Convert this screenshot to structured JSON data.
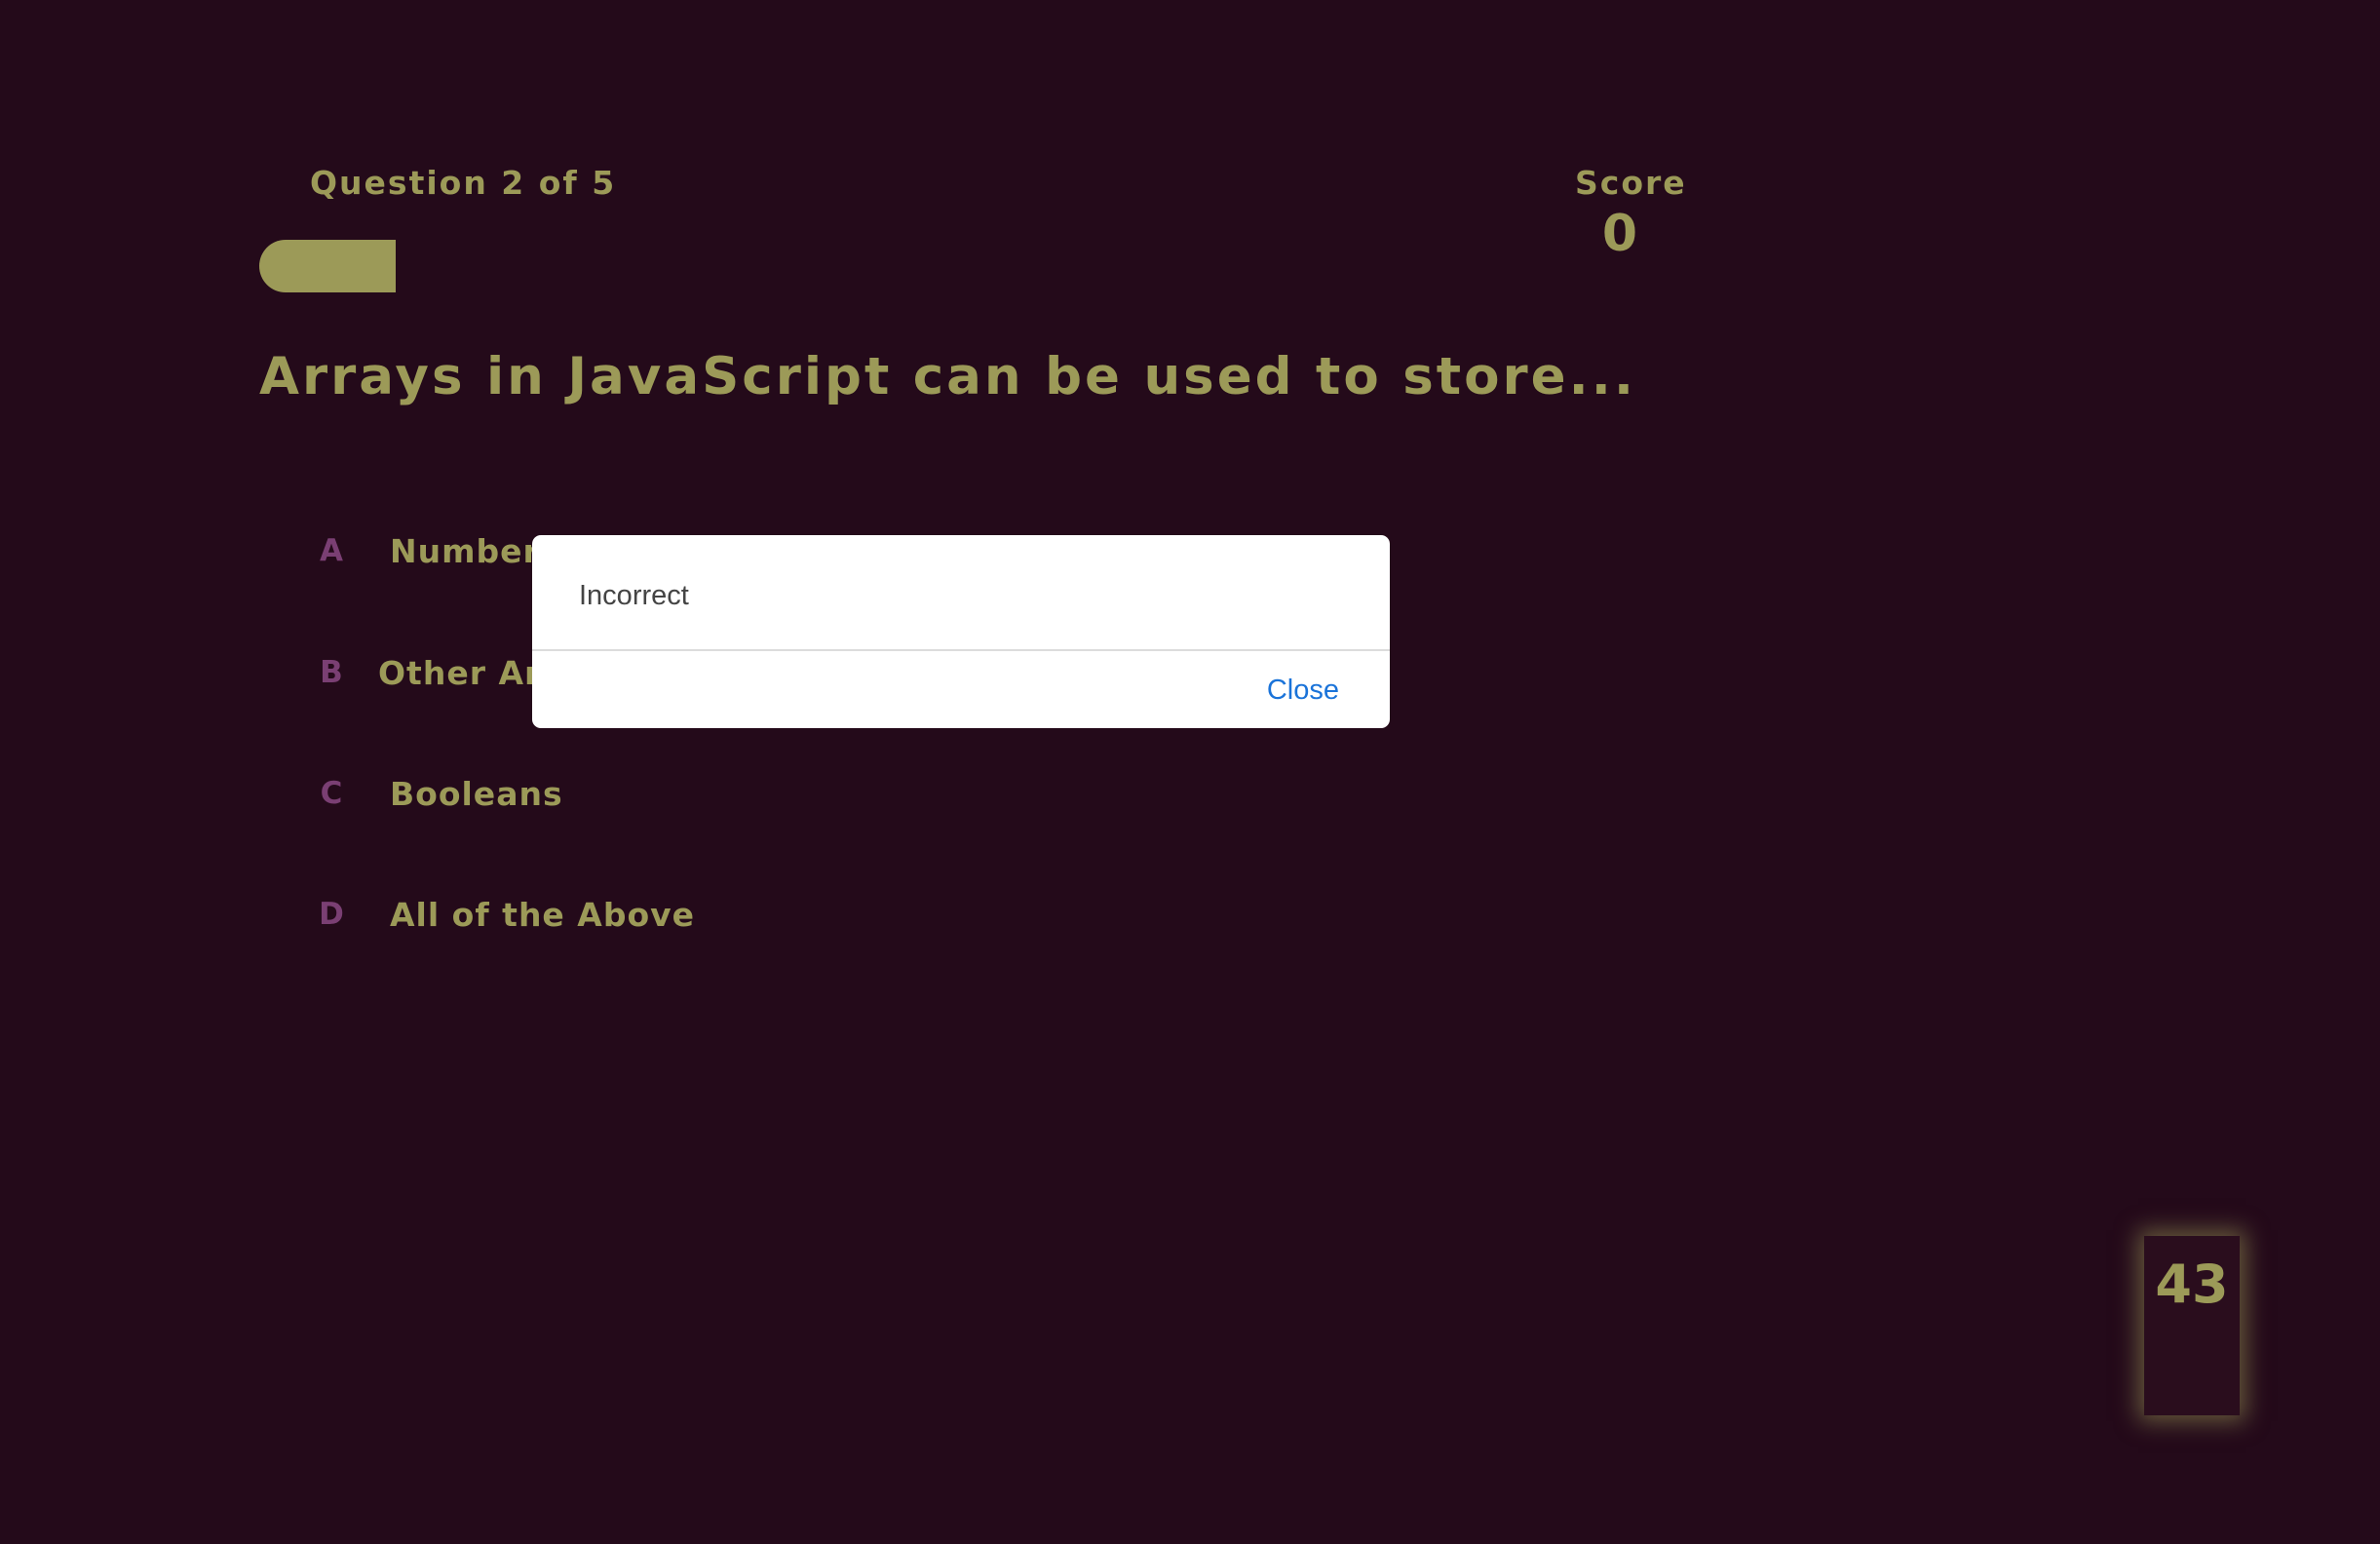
{
  "header": {
    "question_counter": "Question 2 of 5",
    "score_label": "Score",
    "score_value": "0",
    "progress_fraction": 0.2
  },
  "question": {
    "text": "Arrays in JavaScript can be used to store..."
  },
  "answers": [
    {
      "letter": "A",
      "text": "Numbers"
    },
    {
      "letter": "B",
      "text": "Other Arrays"
    },
    {
      "letter": "C",
      "text": "Booleans"
    },
    {
      "letter": "D",
      "text": "All of the Above"
    }
  ],
  "timer": {
    "value": "43"
  },
  "modal": {
    "message": "Incorrect",
    "close_label": "Close"
  },
  "colors": {
    "background": "#240a1a",
    "accent": "#9c9a58",
    "answer_letter": "#7a3f73",
    "modal_link": "#1a73d9"
  }
}
